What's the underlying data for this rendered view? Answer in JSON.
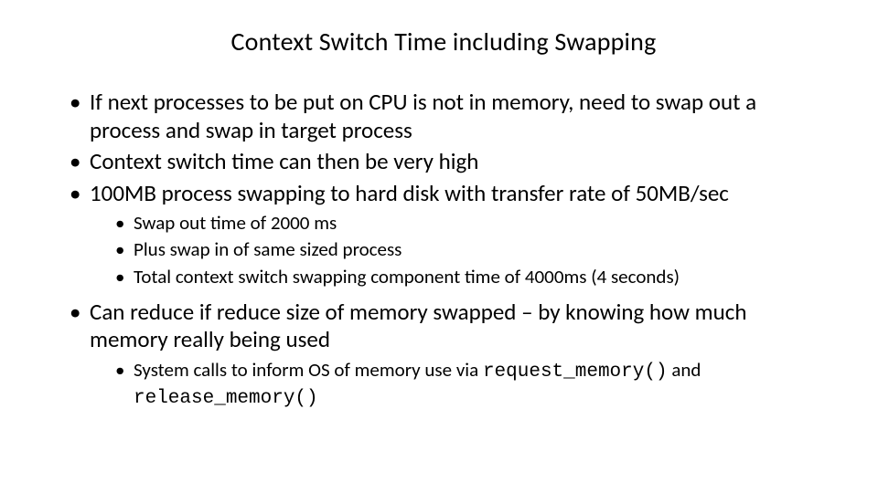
{
  "title": "Context Switch Time including Swapping",
  "bullets": {
    "b1": "If next processes to be put on CPU is not in memory, need to swap out a process and swap in target process",
    "b2": "Context switch time can then be very high",
    "b3": "100MB process swapping to hard disk with transfer rate of 50MB/sec",
    "b3_sub": {
      "s1": "Swap out time of 2000 ms",
      "s2": "Plus swap in of same sized process",
      "s3": "Total context switch swapping component time of 4000ms (4 seconds)"
    },
    "b4": "Can reduce if reduce size of memory swapped – by knowing how much memory really being used",
    "b4_sub": {
      "s1_prefix": "System calls to inform OS of memory use via ",
      "s1_code1": "request_memory()",
      "s1_mid": " and ",
      "s1_code2": "release_memory()"
    }
  }
}
